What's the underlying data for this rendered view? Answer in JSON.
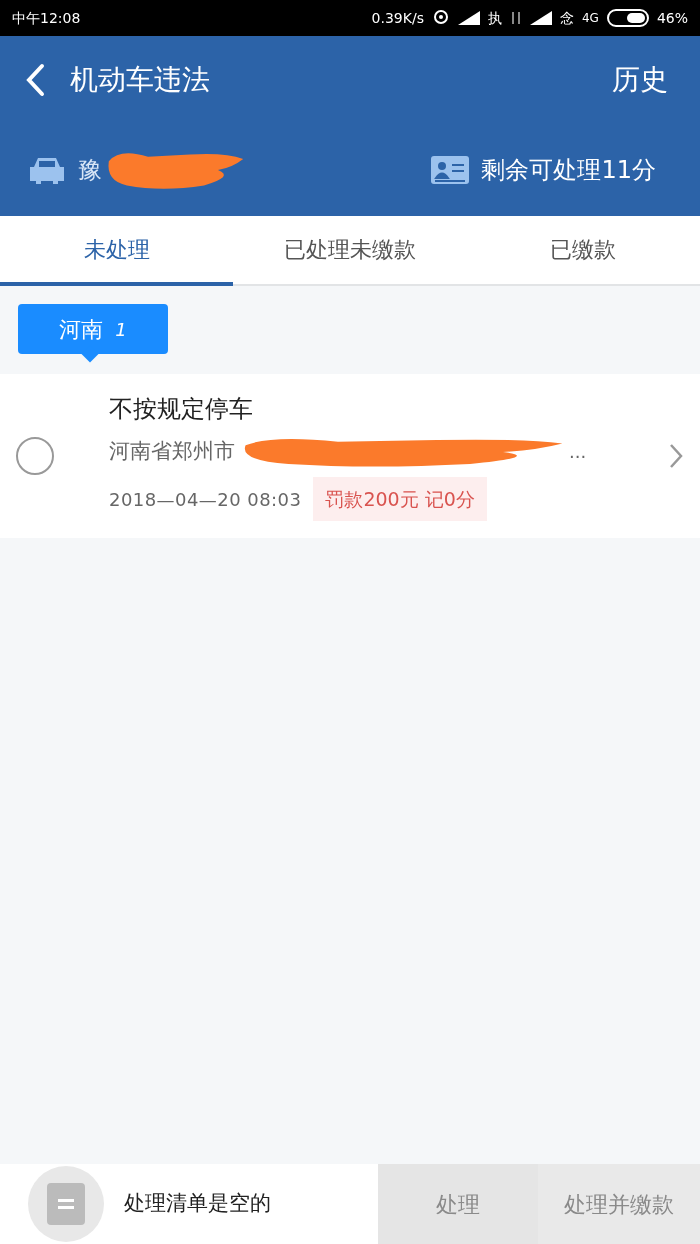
{
  "status_bar": {
    "time": "中午12:08",
    "speed": "0.39K/s",
    "carrier_1": "执",
    "carrier_2": "念",
    "network": "4G",
    "battery": "46%"
  },
  "header": {
    "title": "机动车违法",
    "action": "历史",
    "plate": "豫",
    "points_text": "剩余可处理11分"
  },
  "tabs": [
    {
      "label": "未处理",
      "selected": true
    },
    {
      "label": "已处理未缴款",
      "selected": false
    },
    {
      "label": "已缴款",
      "selected": false
    }
  ],
  "region_tag": {
    "label": "河南",
    "count": "1"
  },
  "violations": [
    {
      "title": "不按规定停车",
      "address": "河南省郑州市",
      "address_tail": "...",
      "time": "2018—04—20 08:03",
      "penalty": "罚款200元 记0分",
      "checked": false
    }
  ],
  "bottom_bar": {
    "message": "处理清单是空的",
    "buttons": [
      {
        "label": "处理",
        "disabled": true
      },
      {
        "label": "处理并缴款",
        "disabled": true
      }
    ]
  }
}
